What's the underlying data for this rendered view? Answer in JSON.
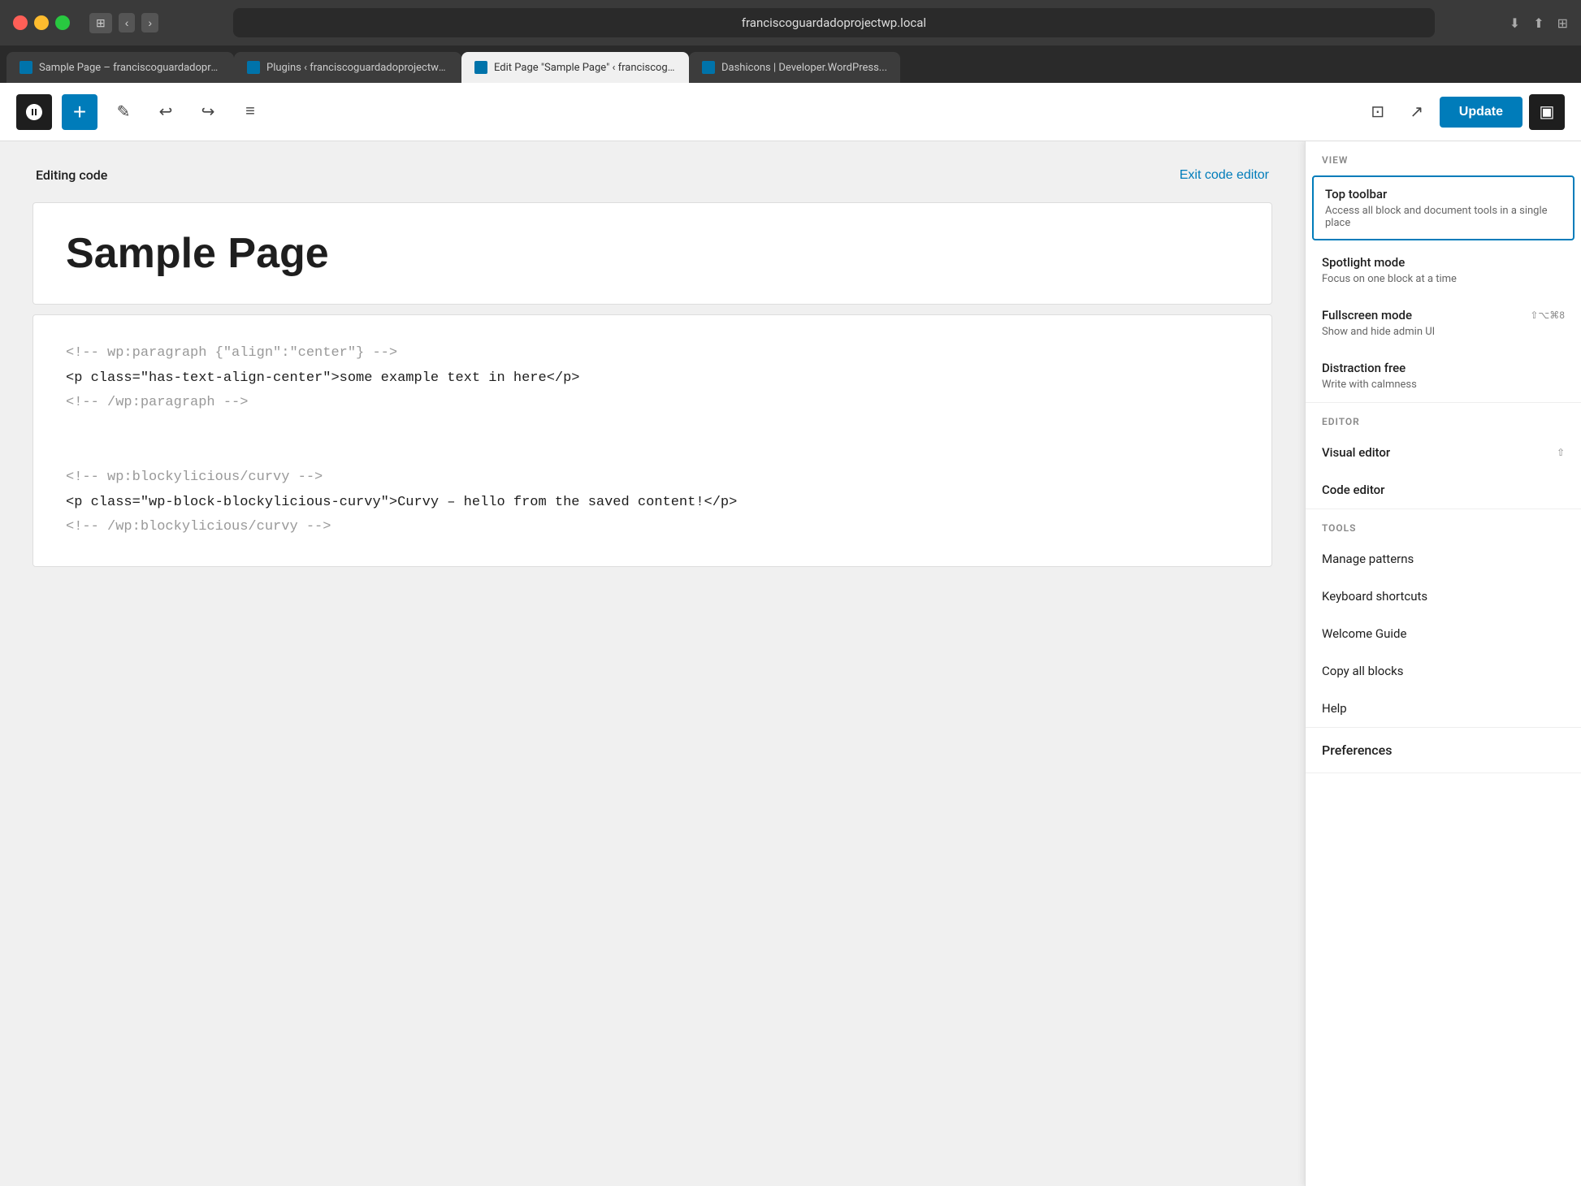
{
  "titlebar": {
    "url": "franciscoguardadoprojectwp.local",
    "traffic_lights": [
      "red",
      "yellow",
      "green"
    ]
  },
  "browser_tabs": [
    {
      "label": "Sample Page – franciscoguardadoprojectwp",
      "active": false,
      "favicon_color": "#0073aa"
    },
    {
      "label": "Plugins ‹ franciscoguardadoprojectwp — Wo...",
      "active": false,
      "favicon_color": "#0073aa"
    },
    {
      "label": "Edit Page \"Sample Page\" ‹ franciscoguardad...",
      "active": true,
      "favicon_color": "#0073aa"
    },
    {
      "label": "Dashicons | Developer.WordPress...",
      "active": false,
      "favicon_color": "#0073aa"
    }
  ],
  "toolbar": {
    "wp_logo_text": "W",
    "add_button_label": "+",
    "undo_icon": "↩",
    "redo_icon": "↪",
    "list_icon": "≡",
    "preview_icon": "⊡",
    "external_icon": "↗",
    "update_label": "Update",
    "sidebar_icon": "▣"
  },
  "editing_code": {
    "label": "Editing code",
    "exit_label": "Exit code editor"
  },
  "code_blocks": [
    {
      "type": "title",
      "content": "Sample Page"
    },
    {
      "type": "code",
      "lines": [
        {
          "type": "comment",
          "text": "<!-- wp:paragraph {\"align\":\"center\"} -->"
        },
        {
          "type": "tag",
          "text": "<p class=\"has-text-align-center\">some example text in here</p>"
        },
        {
          "type": "comment",
          "text": "<!-- /wp:paragraph -->"
        },
        {
          "type": "blank",
          "text": ""
        },
        {
          "type": "blank",
          "text": ""
        },
        {
          "type": "comment",
          "text": "<!-- wp:blockylicious/curvy -->"
        },
        {
          "type": "tag",
          "text": "<p class=\"wp-block-blockylicious-curvy\">Curvy – hello from the saved content!</p>"
        },
        {
          "type": "comment",
          "text": "<!-- /wp:blockylicious/curvy -->"
        }
      ]
    }
  ],
  "dropdown": {
    "view_section": {
      "label": "VIEW",
      "items": [
        {
          "id": "top-toolbar",
          "title": "Top toolbar",
          "desc": "Access all block and document tools in a single place",
          "active": true
        },
        {
          "id": "spotlight-mode",
          "title": "Spotlight mode",
          "desc": "Focus on one block at a time",
          "active": false
        },
        {
          "id": "fullscreen-mode",
          "title": "Fullscreen mode",
          "desc": "Show and hide admin UI",
          "shortcut": "⇧⌥⌘8",
          "active": false
        },
        {
          "id": "distraction-free",
          "title": "Distraction free",
          "desc": "Write with calmness",
          "active": false
        }
      ]
    },
    "editor_section": {
      "label": "EDITOR",
      "items": [
        {
          "id": "visual-editor",
          "title": "Visual editor",
          "shortcut": "⇧"
        },
        {
          "id": "code-editor",
          "title": "Code editor"
        }
      ]
    },
    "tools_section": {
      "label": "TOOLS",
      "items": [
        {
          "id": "manage-patterns",
          "label": "Manage patterns"
        },
        {
          "id": "keyboard-shortcuts",
          "label": "Keyboard shortcuts"
        },
        {
          "id": "welcome-guide",
          "label": "Welcome Guide"
        },
        {
          "id": "copy-all-blocks",
          "label": "Copy all blocks"
        },
        {
          "id": "help",
          "label": "Help"
        }
      ]
    },
    "preferences_section": {
      "items": [
        {
          "id": "preferences",
          "label": "Preferences"
        }
      ]
    }
  }
}
